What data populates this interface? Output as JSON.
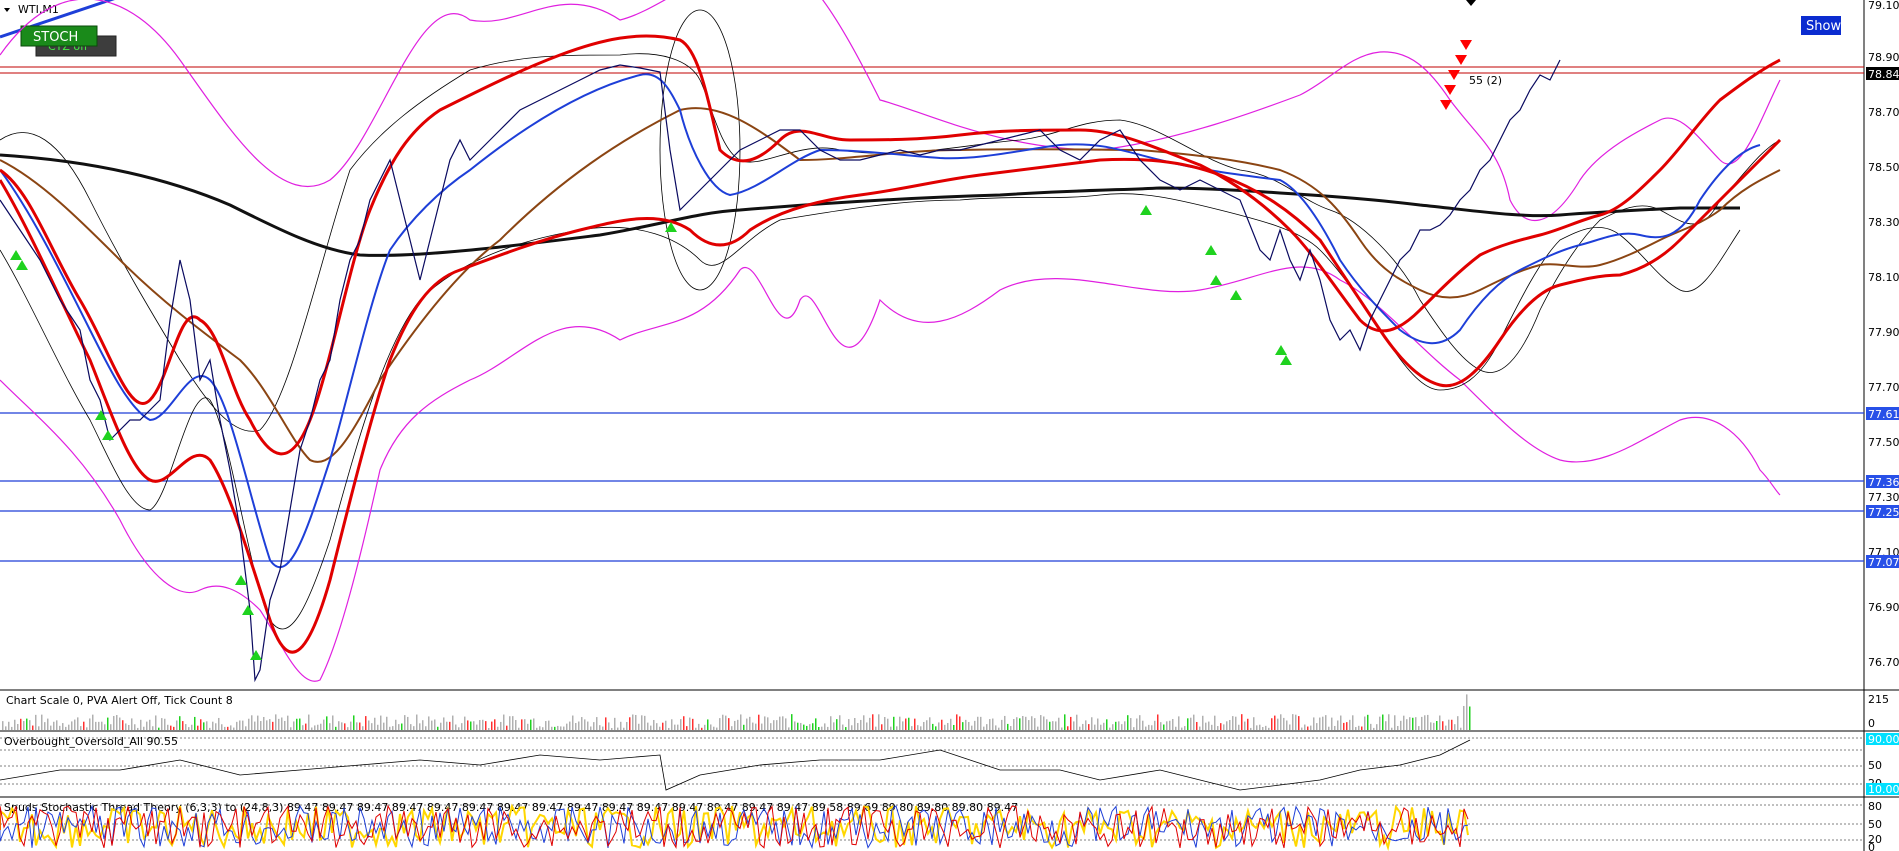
{
  "window": {
    "title": "WTI,M1"
  },
  "buttons": {
    "stoch": "STOCH",
    "stoch_under": "CTZ off",
    "show": "Show"
  },
  "main_panel": {
    "price_labels": [
      "79.10",
      "78.90",
      "78.70",
      "78.50",
      "78.30",
      "78.10",
      "77.90",
      "77.70",
      "77.50",
      "77.30",
      "77.10",
      "76.90",
      "76.70"
    ],
    "hline_tags": [
      "78.84",
      "77.61",
      "77.36",
      "77.25",
      "77.07"
    ],
    "annotation": "55 (2)"
  },
  "volume_panel": {
    "label": "Chart Scale  0,   PVA Alert Off,   Tick Count  8",
    "scale": [
      "215",
      "0"
    ]
  },
  "ob_panel": {
    "label": "Overbought_Oversold_All 90.55",
    "scale": [
      "50",
      "20"
    ],
    "tags": [
      "90.00",
      "10.00"
    ]
  },
  "stoch_panel": {
    "label": "Spuds Stochastic Thread Theory (6,3,3) to (24,8,3) 89.47 89.47 89.47 89.47 89.47 89.47 89.47 89.47 89.47 89.47 89.47 89.47 89.47 89.47 89.47 89.58 89.69 89.80 89.80 89.80 89.47",
    "scale": [
      "80",
      "50",
      "20",
      "0"
    ]
  },
  "colors": {
    "bull": "#1fd21f",
    "bear": "#ff0000",
    "line_blue": "#1e3fd8",
    "bb_magenta": "#e020e0",
    "ma_brown": "#8b4513",
    "tag_blue": "#2850e8"
  }
}
